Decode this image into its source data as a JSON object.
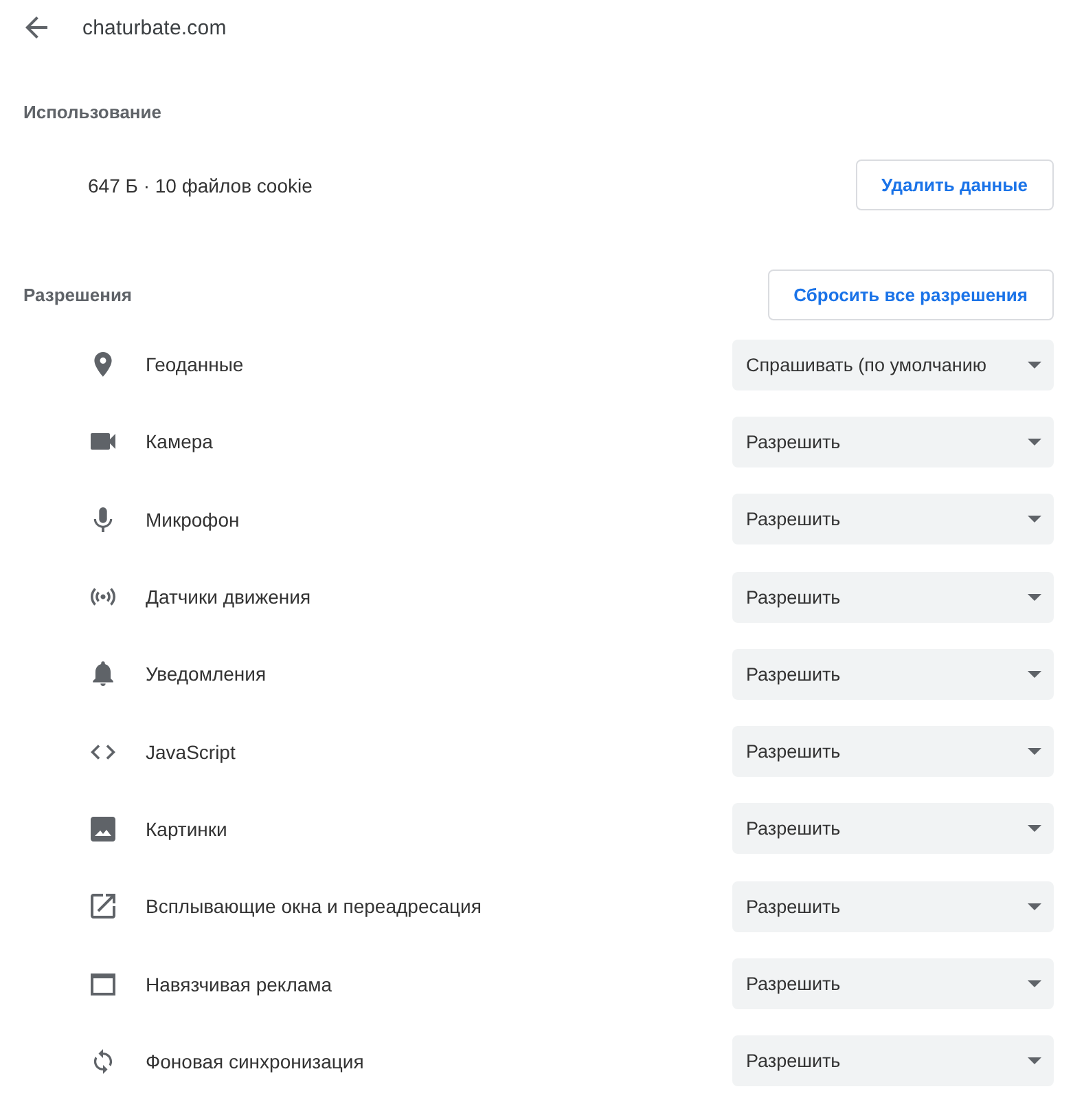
{
  "header": {
    "title": "chaturbate.com"
  },
  "usage": {
    "heading": "Использование",
    "summary": "647 Б · 10 файлов cookie",
    "button": "Удалить данные"
  },
  "permissions": {
    "heading": "Разрешения",
    "reset_button": "Сбросить все разрешения",
    "items": [
      {
        "kind": "location",
        "label": "Геоданные",
        "value": "Спрашивать (по умолчанию"
      },
      {
        "kind": "camera",
        "label": "Камера",
        "value": "Разрешить"
      },
      {
        "kind": "microphone",
        "label": "Микрофон",
        "value": "Разрешить"
      },
      {
        "kind": "sensors",
        "label": "Датчики движения",
        "value": "Разрешить"
      },
      {
        "kind": "notifications",
        "label": "Уведомления",
        "value": "Разрешить"
      },
      {
        "kind": "javascript",
        "label": "JavaScript",
        "value": "Разрешить"
      },
      {
        "kind": "images",
        "label": "Картинки",
        "value": "Разрешить"
      },
      {
        "kind": "popups",
        "label": "Всплывающие окна и переадресация",
        "value": "Разрешить"
      },
      {
        "kind": "ads",
        "label": "Навязчивая реклама",
        "value": "Разрешить"
      },
      {
        "kind": "sync",
        "label": "Фоновая синхронизация",
        "value": "Разрешить"
      }
    ]
  }
}
